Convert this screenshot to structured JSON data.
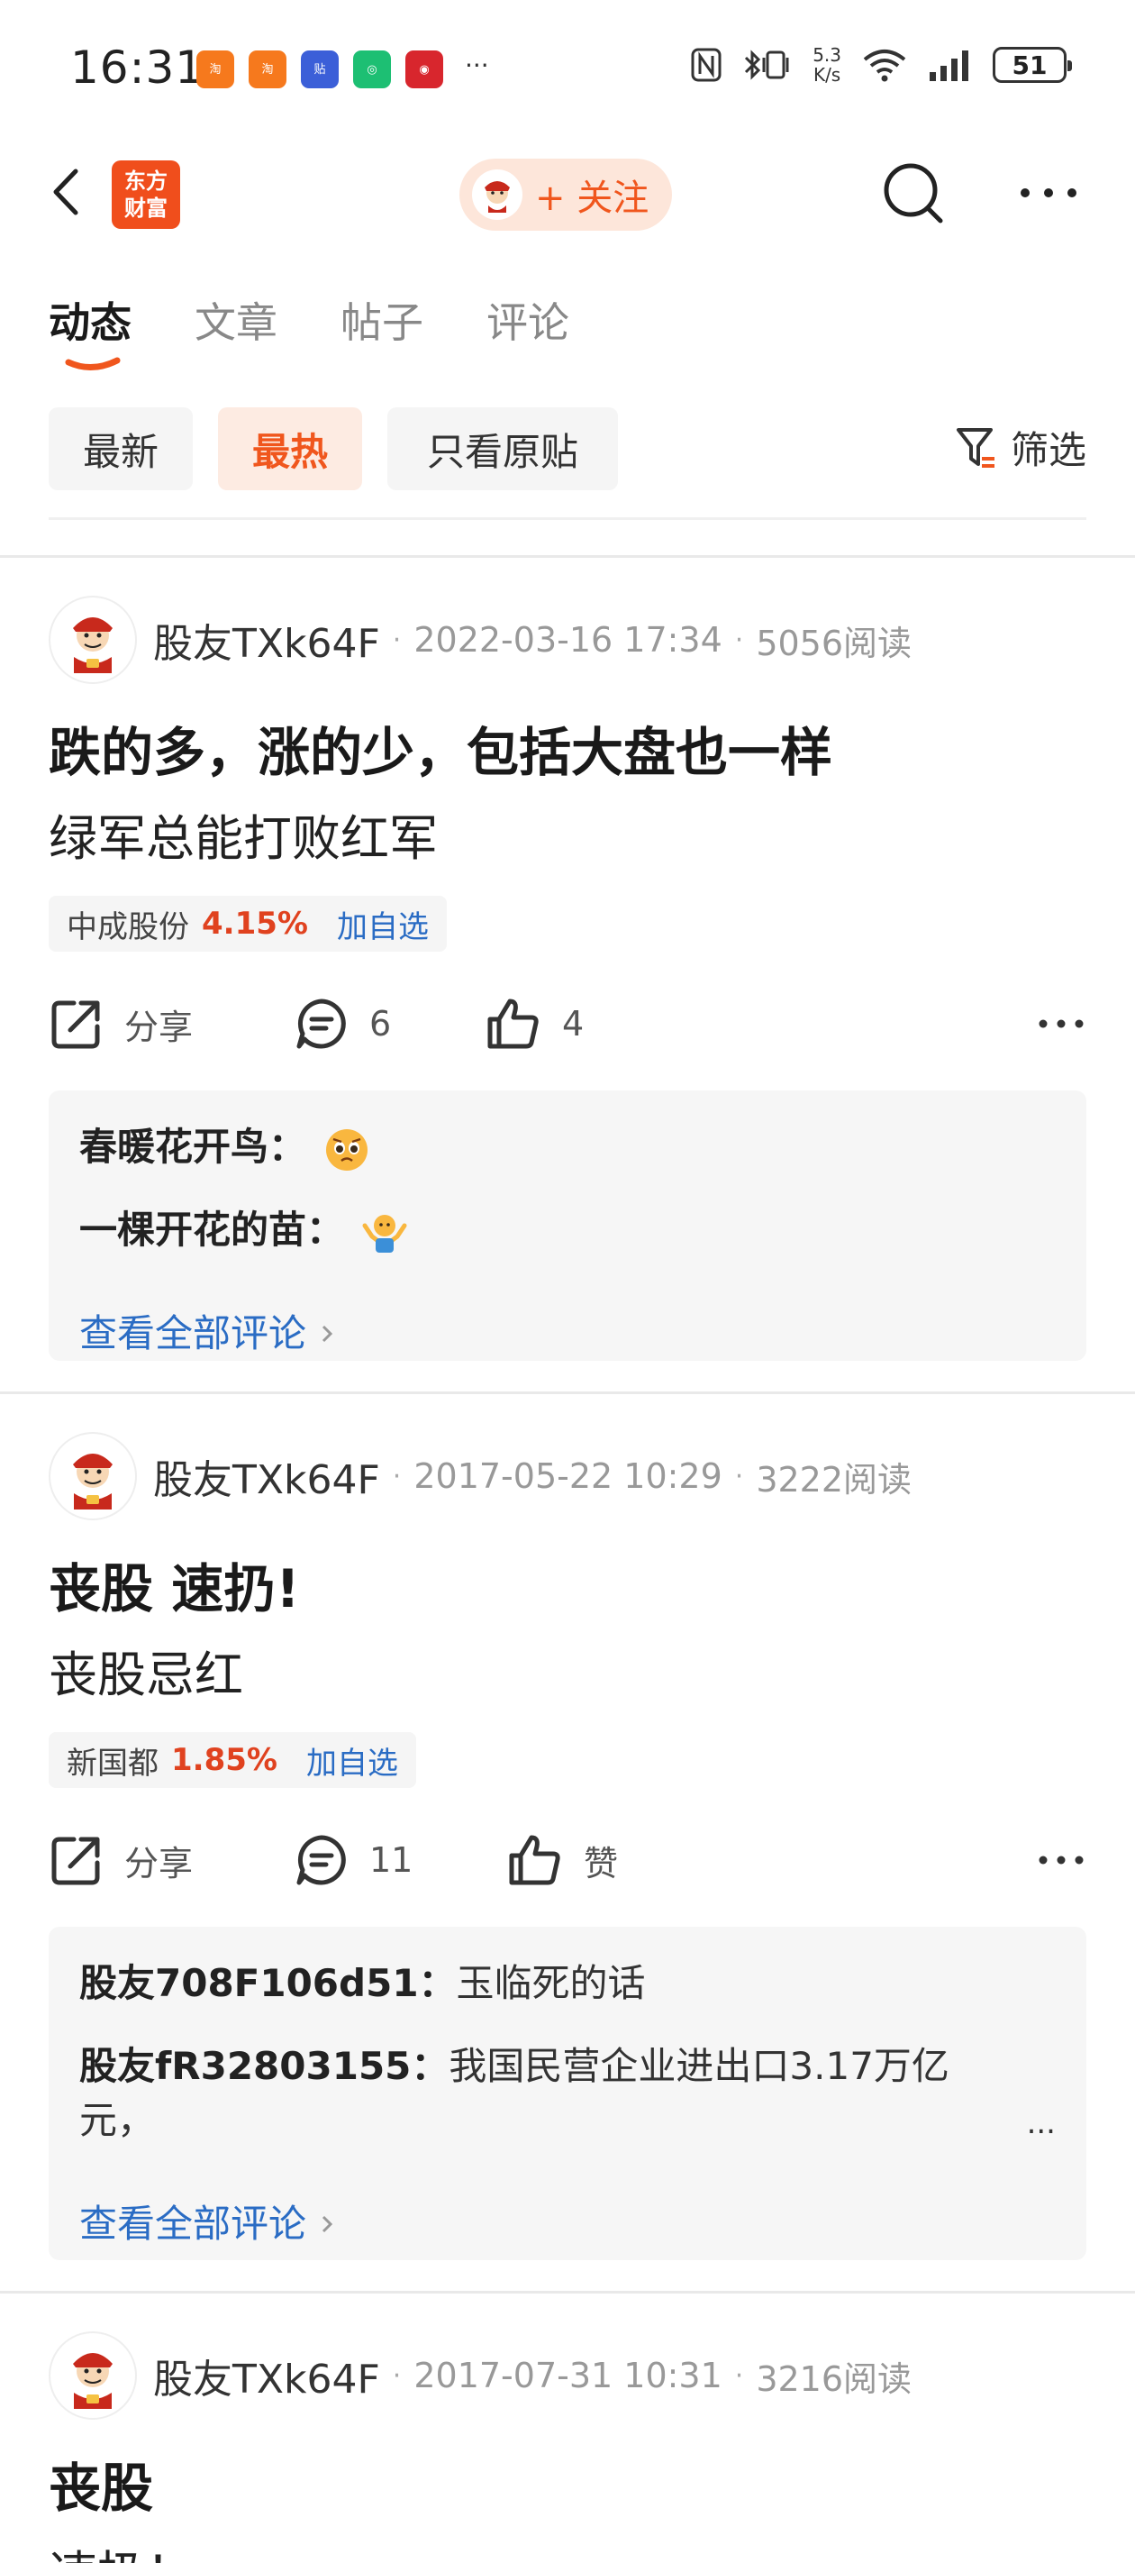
{
  "status_bar": {
    "time": "16:31",
    "net_speed_value": "5.3",
    "net_speed_unit": "K/s",
    "battery": "51",
    "app_icons": [
      "taobao-flash-icon",
      "taobao-flash-icon",
      "tieba-icon",
      "app-icon",
      "citic-icon"
    ],
    "more": "···"
  },
  "header": {
    "logo_line1": "东方",
    "logo_line2": "财富",
    "follow_label": "+ 关注"
  },
  "tabs": [
    {
      "label": "动态",
      "active": true
    },
    {
      "label": "文章",
      "active": false
    },
    {
      "label": "帖子",
      "active": false
    },
    {
      "label": "评论",
      "active": false
    }
  ],
  "filters": {
    "chips": [
      "最新",
      "最热",
      "只看原贴"
    ],
    "active": "最热",
    "filter_label": "筛选"
  },
  "posts": [
    {
      "user": "股友TXk64F",
      "date": "2022-03-16 17:34",
      "reads": "5056阅读",
      "title": "跌的多，涨的少，包括大盘也一样",
      "body": "绿军总能打败红军",
      "stock": {
        "name": "中成股份",
        "pct": "4.15%",
        "add": "加自选"
      },
      "share": "分享",
      "comments_count": "6",
      "likes": "4",
      "comments": [
        {
          "user": "春暖花开鸟：",
          "text": ""
        },
        {
          "user": "一棵开花的苗：",
          "text": ""
        }
      ],
      "view_all": "查看全部评论"
    },
    {
      "user": "股友TXk64F",
      "date": "2017-05-22 10:29",
      "reads": "3222阅读",
      "title": "丧股 速扔!",
      "body": "丧股忌红",
      "stock": {
        "name": "新国都",
        "pct": "1.85%",
        "add": "加自选"
      },
      "share": "分享",
      "comments_count": "11",
      "likes": "赞",
      "comments": [
        {
          "user": "股友708F106d51：",
          "text": "玉临死的话"
        },
        {
          "user": "股友fR32803155：",
          "text": "我国民营企业进出口3.17万亿",
          "text2": "元，",
          "more": "..."
        }
      ],
      "view_all": "查看全部评论"
    },
    {
      "user": "股友TXk64F",
      "date": "2017-07-31 10:31",
      "reads": "3216阅读",
      "title": "丧股",
      "body": "速扔！"
    }
  ]
}
